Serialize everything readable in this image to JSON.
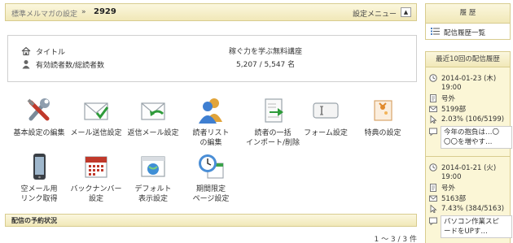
{
  "header": {
    "breadcrumb": "標準メルマガの設定",
    "separator": "»",
    "magazine_id": "2929",
    "settings_menu": "設定メニュー",
    "menu_toggle": "▲"
  },
  "info": {
    "title_label": "タイトル",
    "title_value": "稼ぐ力を学ぶ無料講座",
    "readers_label": "有効読者数/総読者数",
    "readers_value": "5,207 / 5,547 名"
  },
  "tiles": [
    {
      "name": "basic-settings",
      "label": "基本設定の編集",
      "icon": "tools-icon"
    },
    {
      "name": "mail-send-settings",
      "label": "メール送信設定",
      "icon": "envelope-check-icon"
    },
    {
      "name": "reply-mail-settings",
      "label": "返信メール設定",
      "icon": "envelope-reply-icon"
    },
    {
      "name": "reader-list-edit",
      "label": "読者リスト\nの編集",
      "icon": "users-icon"
    },
    {
      "name": "reader-bulk-import",
      "label": "読者の一括\nインポート/削除",
      "icon": "import-icon"
    },
    {
      "name": "form-settings",
      "label": "フォーム設定",
      "icon": "form-icon"
    },
    {
      "name": "bonus-settings",
      "label": "特典の設定",
      "icon": "gift-icon"
    },
    {
      "name": "empty-mail-link",
      "label": "空メール用\nリンク取得",
      "icon": "phone-icon"
    },
    {
      "name": "backnumber-settings",
      "label": "バックナンバー\n設定",
      "icon": "calendar-icon"
    },
    {
      "name": "default-display-settings",
      "label": "デフォルト\n表示設定",
      "icon": "browser-icon"
    },
    {
      "name": "limited-page-settings",
      "label": "期間限定\nページ設定",
      "icon": "clock-calendar-icon"
    }
  ],
  "schedule": {
    "title": "配信の予約状況",
    "pager": "1 ～ 3 / 3 件"
  },
  "sidebar": {
    "history_title": "履 歴",
    "history_link": "配信履歴一覧",
    "recent_title": "最近10回の配信履歴",
    "entries": [
      {
        "date": "2014-01-23 (木)",
        "time": "19:00",
        "issue": "号外",
        "count": "5199部",
        "rate": "2.03% (106/5199)",
        "subject": "今年の抱負は…〇\n〇〇を増やす…"
      },
      {
        "date": "2014-01-21 (火)",
        "time": "19:00",
        "issue": "号外",
        "count": "5163部",
        "rate": "7.43% (384/5163)",
        "subject": "パソコン作業スピ\nードをUPす…"
      }
    ]
  },
  "colors": {
    "header_bg": "#f1e8b8",
    "header_border": "#d8cc8f",
    "log_bg": "#fbf6d6"
  }
}
